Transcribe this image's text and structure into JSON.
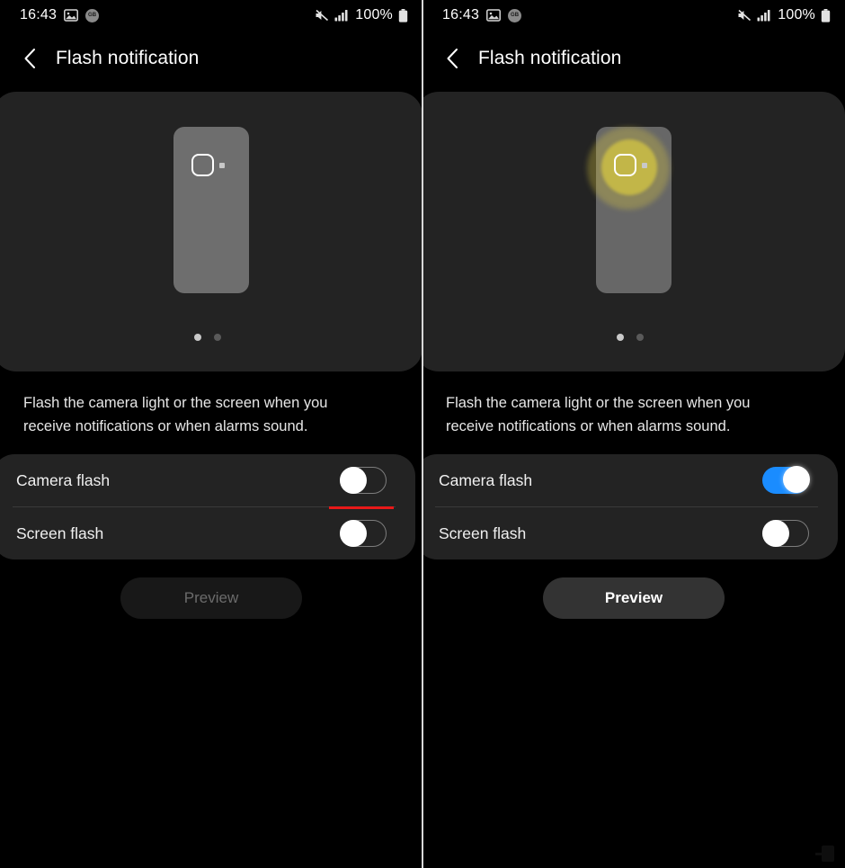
{
  "status_bar": {
    "time": "16:43",
    "battery_percent": "100%",
    "icons": [
      "photo-icon",
      "app-badge-icon",
      "mute-icon",
      "signal-icon",
      "battery-icon"
    ],
    "badge_text": "GB"
  },
  "header": {
    "title": "Flash notification",
    "back_icon": "chevron-left-icon"
  },
  "illustration": {
    "camera_icon": "camera-lens-icon",
    "led_icon": "flash-led-icon",
    "dots": [
      {
        "active": true
      },
      {
        "active": false
      }
    ]
  },
  "description": "Flash the camera light or the screen when you receive notifications or when alarms sound.",
  "settings": {
    "camera_flash_label": "Camera flash",
    "screen_flash_label": "Screen flash"
  },
  "preview": {
    "label": "Preview"
  },
  "colors": {
    "accent_on": "#1a8cff",
    "annotation_red": "#e81919",
    "card_bg": "#232323",
    "page_bg": "#000000",
    "flash_glow": "#e4d33e"
  },
  "left_panel": {
    "camera_flash_state": "off",
    "screen_flash_state": "off",
    "preview_enabled": false,
    "flash_active": false,
    "has_annotation": true
  },
  "right_panel": {
    "camera_flash_state": "on",
    "screen_flash_state": "off",
    "preview_enabled": true,
    "flash_active": true,
    "has_annotation": false
  }
}
